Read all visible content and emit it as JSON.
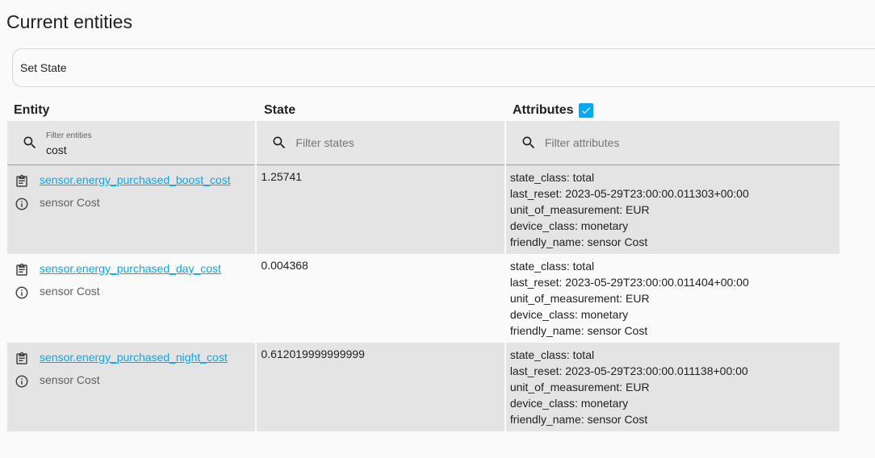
{
  "page": {
    "title": "Current entities"
  },
  "set_state": {
    "label": "Set State"
  },
  "columns": {
    "entity": "Entity",
    "state": "State",
    "attributes": "Attributes",
    "attributes_checked": true
  },
  "filters": {
    "entities_label": "Filter entities",
    "entities_value": "cost",
    "states_placeholder": "Filter states",
    "attributes_placeholder": "Filter attributes"
  },
  "rows": [
    {
      "entity_id": "sensor.energy_purchased_boost_cost",
      "friendly_name": "sensor Cost",
      "state": "1.25741",
      "attributes": [
        "state_class: total",
        "last_reset: 2023-05-29T23:00:00.011303+00:00",
        "unit_of_measurement: EUR",
        "device_class: monetary",
        "friendly_name: sensor Cost"
      ]
    },
    {
      "entity_id": "sensor.energy_purchased_day_cost",
      "friendly_name": "sensor Cost",
      "state": "0.004368",
      "attributes": [
        "state_class: total",
        "last_reset: 2023-05-29T23:00:00.011404+00:00",
        "unit_of_measurement: EUR",
        "device_class: monetary",
        "friendly_name: sensor Cost"
      ]
    },
    {
      "entity_id": "sensor.energy_purchased_night_cost",
      "friendly_name": "sensor Cost",
      "state": "0.612019999999999",
      "attributes": [
        "state_class: total",
        "last_reset: 2023-05-29T23:00:00.011138+00:00",
        "unit_of_measurement: EUR",
        "device_class: monetary",
        "friendly_name: sensor Cost"
      ]
    }
  ],
  "icons": {
    "search": "search-icon",
    "clipboard": "clipboard-icon",
    "info": "info-icon",
    "check": "check-icon"
  },
  "colors": {
    "accent": "#03a9f4",
    "row_alt": "#e4e4e4",
    "filter_bg": "#e6e6e6"
  }
}
